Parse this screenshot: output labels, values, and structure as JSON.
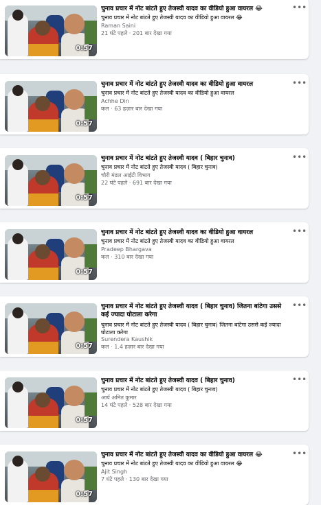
{
  "videos": [
    {
      "title": "चुनाव प्रचार में नोट बांटते हुए तेजस्वी यादव का वीडियो हुआ वायरल 😂",
      "description": "चुनाव प्रचार में नोट बांटते हुए तेजस्वी यादव का वीडियो हुआ वायरल 😂",
      "author": "Raman Saini",
      "meta": "21 घंटे पहले · 201 बार देखा गया",
      "duration": "0:57",
      "more": "•••"
    },
    {
      "title": "चुनाव प्रचार में नोट बांटते हुए तेजस्वी यादव का वीडियो हुआ वायरल",
      "description": "चुनाव प्रचार में नोट बांटते हुए तेजस्वी यादव का वीडियो हुआ वायरल",
      "author": "Achhe Din",
      "meta": "कल · 63 हज़ार बार देखा गया",
      "duration": "0:57",
      "more": "•••"
    },
    {
      "title": "चुनाव प्रचार में नोट बांटते हुए तेजस्वी यादव ( बिहार चुनाव)",
      "description": "चुनाव प्रचार में नोट बांटते हुए तेजस्वी यादव ( बिहार चुनाव)",
      "author": "चौरी मंडल आईटी विभाग",
      "meta": "22 घंटे पहले · 691 बार देखा गया",
      "duration": "0:57",
      "more": "•••"
    },
    {
      "title": "चुनाव प्रचार में नोट बांटते हुए तेजस्वी यादव का वीडियो हुआ वायरल",
      "description": "चुनाव प्रचार में नोट बांटते हुए तेजस्वी यादव का वीडियो हुआ वायरल",
      "author": "Pradeep Bhargava",
      "meta": "कल · 310 बार देखा गया",
      "duration": "0:57",
      "more": "•••"
    },
    {
      "title": "चुनाव प्रचार में नोट बांटते हुए तेजस्वी यादव ( बिहार चुनाव) जितना बांटेगा उससे कई ज्यादा घोटाला करेगा",
      "description": "चुनाव प्रचार में नोट बांटते हुए तेजस्वी यादव ( बिहार चुनाव) जितना बांटेगा उससे कई ज्यादा घोटाला करेगा",
      "author": "Surendera Kaushik",
      "meta": "कल · 1.4 हज़ार बार देखा गया",
      "duration": "0:57",
      "more": "•••"
    },
    {
      "title": "चुनाव प्रचार में नोट बांटते हुए तेजस्वी यादव ( बिहार चुनाव)",
      "description": "चुनाव प्रचार में नोट बांटते हुए तेजस्वी यादव ( बिहार चुनाव)",
      "author": "आर्य अमित कुमार",
      "meta": "14 घंटे पहले · 528 बार देखा गया",
      "duration": "0:57",
      "more": "•••"
    },
    {
      "title": "चुनाव प्रचार में नोट बांटते हुए तेजस्वी यादव का वीडियो हुआ वायरल 😂",
      "description": "चुनाव प्रचार में नोट बांटते हुए तेजस्वी यादव का वीडियो हुआ वायरल 😂",
      "author": "Ajit Singh",
      "meta": "7 घंटे पहले · 130 बार देखा गया",
      "duration": "0:57",
      "more": "•••"
    }
  ]
}
